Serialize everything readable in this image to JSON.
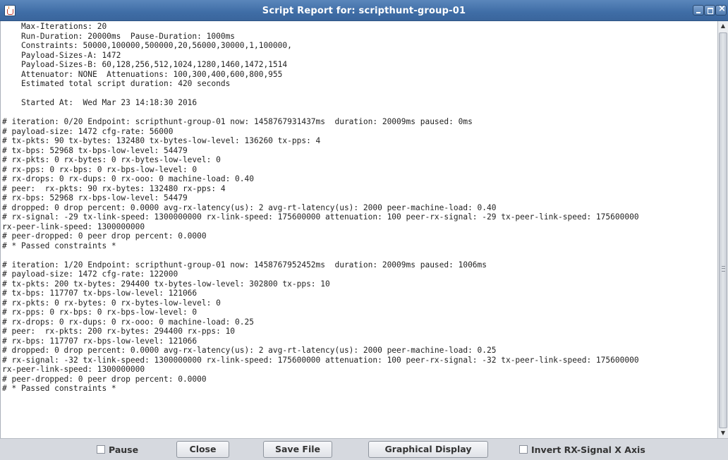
{
  "window": {
    "title": "Script Report for: scripthunt-group-01"
  },
  "report_lines": [
    "    Max-Iterations: 20",
    "    Run-Duration: 20000ms  Pause-Duration: 1000ms",
    "    Constraints: 50000,100000,500000,20,56000,30000,1,100000,",
    "    Payload-Sizes-A: 1472",
    "    Payload-Sizes-B: 60,128,256,512,1024,1280,1460,1472,1514",
    "    Attenuator: NONE  Attenuations: 100,300,400,600,800,955",
    "    Estimated total script duration: 420 seconds",
    "",
    "    Started At:  Wed Mar 23 14:18:30 2016",
    "",
    "# iteration: 0/20 Endpoint: scripthunt-group-01 now: 1458767931437ms  duration: 20009ms paused: 0ms",
    "# payload-size: 1472 cfg-rate: 56000",
    "# tx-pkts: 90 tx-bytes: 132480 tx-bytes-low-level: 136260 tx-pps: 4",
    "# tx-bps: 52968 tx-bps-low-level: 54479",
    "# rx-pkts: 0 rx-bytes: 0 rx-bytes-low-level: 0",
    "# rx-pps: 0 rx-bps: 0 rx-bps-low-level: 0",
    "# rx-drops: 0 rx-dups: 0 rx-ooo: 0 machine-load: 0.40",
    "# peer:  rx-pkts: 90 rx-bytes: 132480 rx-pps: 4",
    "# rx-bps: 52968 rx-bps-low-level: 54479",
    "# dropped: 0 drop percent: 0.0000 avg-rx-latency(us): 2 avg-rt-latency(us): 2000 peer-machine-load: 0.40",
    "# rx-signal: -29 tx-link-speed: 1300000000 rx-link-speed: 175600000 attenuation: 100 peer-rx-signal: -29 tx-peer-link-speed: 175600000",
    "rx-peer-link-speed: 1300000000",
    "# peer-dropped: 0 peer drop percent: 0.0000",
    "# * Passed constraints *",
    "",
    "# iteration: 1/20 Endpoint: scripthunt-group-01 now: 1458767952452ms  duration: 20009ms paused: 1006ms",
    "# payload-size: 1472 cfg-rate: 122000",
    "# tx-pkts: 200 tx-bytes: 294400 tx-bytes-low-level: 302800 tx-pps: 10",
    "# tx-bps: 117707 tx-bps-low-level: 121066",
    "# rx-pkts: 0 rx-bytes: 0 rx-bytes-low-level: 0",
    "# rx-pps: 0 rx-bps: 0 rx-bps-low-level: 0",
    "# rx-drops: 0 rx-dups: 0 rx-ooo: 0 machine-load: 0.25",
    "# peer:  rx-pkts: 200 rx-bytes: 294400 rx-pps: 10",
    "# rx-bps: 117707 rx-bps-low-level: 121066",
    "# dropped: 0 drop percent: 0.0000 avg-rx-latency(us): 2 avg-rt-latency(us): 2000 peer-machine-load: 0.25",
    "# rx-signal: -32 tx-link-speed: 1300000000 rx-link-speed: 175600000 attenuation: 100 peer-rx-signal: -32 tx-peer-link-speed: 175600000",
    "rx-peer-link-speed: 1300000000",
    "# peer-dropped: 0 peer drop percent: 0.0000",
    "# * Passed constraints *"
  ],
  "buttons": {
    "pause_label": "Pause",
    "close_label": "Close",
    "save_label": "Save File",
    "graph_label": "Graphical Display",
    "invert_label": "Invert RX-Signal X Axis"
  },
  "colors": {
    "titlebar": "#3f6da6",
    "text": "#222222"
  }
}
